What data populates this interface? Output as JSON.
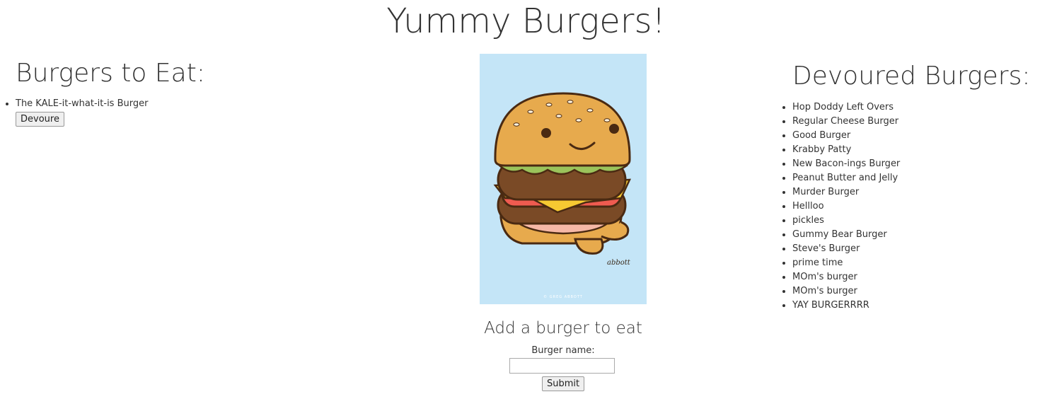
{
  "page": {
    "title": "Yummy Burgers!"
  },
  "to_eat": {
    "heading": "Burgers to Eat:",
    "items": [
      {
        "name": "The KALE-it-what-it-is Burger",
        "button_label": "Devoure"
      }
    ]
  },
  "image": {
    "icon": "burger-illustration",
    "background_color": "#c4e5f7",
    "signature": "abbott",
    "footer_credit": "© GREG ABBOTT"
  },
  "form": {
    "heading": "Add a burger to eat",
    "label": "Burger name:",
    "input_value": "",
    "submit_label": "Submit"
  },
  "devoured": {
    "heading": "Devoured Burgers:",
    "items": [
      "Hop Doddy Left Overs",
      "Regular Cheese Burger",
      "Good Burger",
      "Krabby Patty",
      "New Bacon-ings Burger",
      "Peanut Butter and Jelly",
      "Murder Burger",
      "Hellloo",
      "pickles",
      "Gummy Bear Burger",
      "Steve's Burger",
      "prime time",
      "MOm's burger",
      "MOm's burger",
      "YAY BURGERRRR"
    ]
  }
}
